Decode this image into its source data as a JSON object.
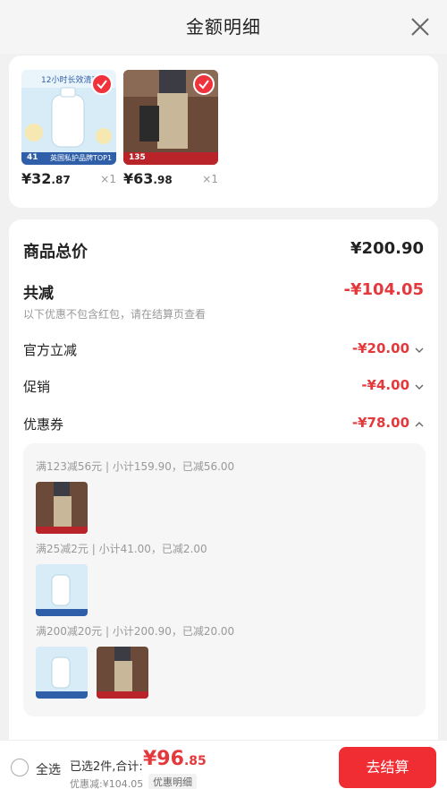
{
  "header": {
    "title": "金额明细"
  },
  "products": [
    {
      "banner": "12小时长效清爽",
      "tag": "英国私护品牌TOP1",
      "chip": "41",
      "price_int": "¥32",
      "price_dec": ".87",
      "qty": "×1"
    },
    {
      "chip": "135",
      "price_int": "¥63",
      "price_dec": ".98",
      "qty": "×1"
    }
  ],
  "details": {
    "total_label": "商品总价",
    "total_value": "¥200.90",
    "reduce_label": "共减",
    "reduce_value": "-¥104.05",
    "reduce_note": "以下优惠不包含红包，请在结算页查看",
    "official_label": "官方立减",
    "official_value": "-¥20.00",
    "promo_label": "促销",
    "promo_value": "-¥4.00",
    "coupon_label": "优惠券",
    "coupon_value": "-¥78.00",
    "coupons": [
      {
        "text": "满123减56元 | 小计159.90，已减56.00"
      },
      {
        "text": "满25减2元 | 小计41.00，已减2.00"
      },
      {
        "text": "满200减20元 | 小计200.90，已减20.00"
      }
    ]
  },
  "bottom": {
    "select_all": "全选",
    "summary": "已选2件,合计:",
    "total_int": "¥96",
    "total_dec": ".85",
    "discount": "优惠减:¥104.05",
    "detail_button": "优惠明细",
    "checkout": "去结算"
  },
  "colors": {
    "accent": "#e4393c",
    "checkout": "#ef2d33"
  }
}
